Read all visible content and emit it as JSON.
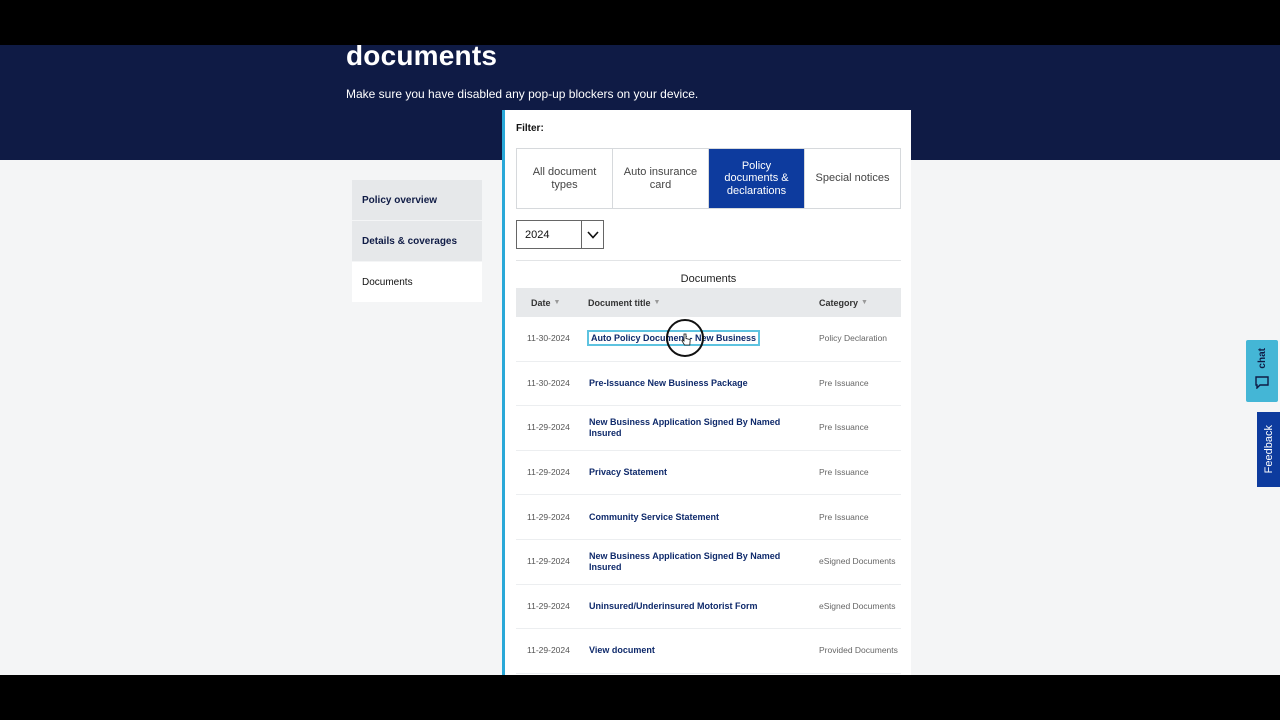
{
  "header": {
    "title": "documents",
    "subtitle": "Make sure you have disabled any pop-up blockers on your device."
  },
  "sidenav": {
    "items": [
      {
        "label": "Policy overview",
        "active": false
      },
      {
        "label": "Details & coverages",
        "active": false
      },
      {
        "label": "Documents",
        "active": true
      }
    ]
  },
  "filter": {
    "label": "Filter:",
    "tabs": [
      {
        "label": "All document types",
        "active": false
      },
      {
        "label": "Auto insurance card",
        "active": false
      },
      {
        "label": "Policy documents & declarations",
        "active": true
      },
      {
        "label": "Special notices",
        "active": false
      }
    ],
    "year": "2024"
  },
  "documents": {
    "heading": "Documents",
    "columns": {
      "date": "Date",
      "title": "Document title",
      "category": "Category"
    },
    "rows": [
      {
        "date": "11-30-2024",
        "title": "Auto Policy Document - New Business",
        "category": "Policy Declaration"
      },
      {
        "date": "11-30-2024",
        "title": "Pre-Issuance New Business Package",
        "category": "Pre Issuance"
      },
      {
        "date": "11-29-2024",
        "title": "New Business Application Signed By Named Insured",
        "category": "Pre Issuance"
      },
      {
        "date": "11-29-2024",
        "title": "Privacy Statement",
        "category": "Pre Issuance"
      },
      {
        "date": "11-29-2024",
        "title": "Community Service Statement",
        "category": "Pre Issuance"
      },
      {
        "date": "11-29-2024",
        "title": "New Business Application Signed By Named Insured",
        "category": "eSigned Documents"
      },
      {
        "date": "11-29-2024",
        "title": "Uninsured/Underinsured Motorist Form",
        "category": "eSigned Documents"
      },
      {
        "date": "11-29-2024",
        "title": "View document",
        "category": "Provided Documents"
      }
    ]
  },
  "widgets": {
    "chat_label": "chat",
    "feedback_label": "Feedback"
  },
  "colors": {
    "hero": "#0f1b45",
    "accent": "#0d3b9e",
    "chat": "#44b6d6",
    "panel_border": "#29a8d8"
  }
}
